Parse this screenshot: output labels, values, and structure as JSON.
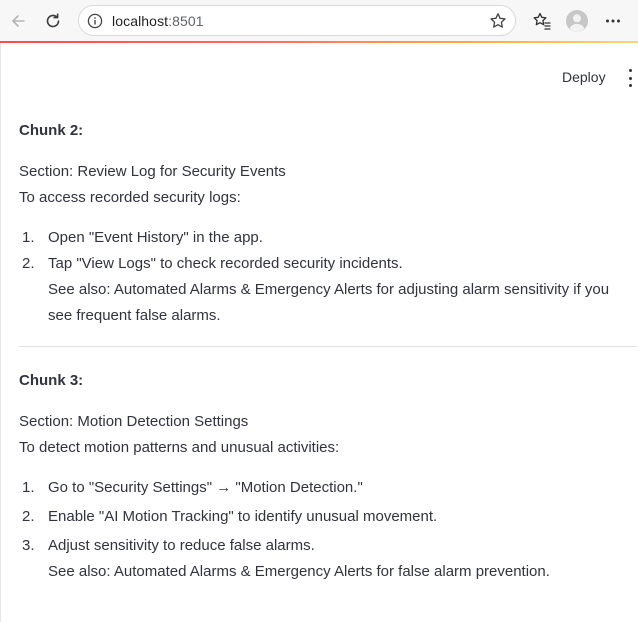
{
  "browser": {
    "url_host": "localhost",
    "url_port": ":8501"
  },
  "header": {
    "deploy_label": "Deploy"
  },
  "chunks": [
    {
      "title": "Chunk 2:",
      "section": "Section: Review Log for Security Events",
      "intro": "To access recorded security logs:",
      "steps": [
        {
          "num": "1.",
          "text": "Open \"Event History\" in the app."
        },
        {
          "num": "2.",
          "text": "Tap \"View Logs\" to check recorded security incidents.",
          "see_also": "See also: Automated Alarms & Emergency Alerts for adjusting alarm sensitivity if you see frequent false alarms."
        }
      ]
    },
    {
      "title": "Chunk 3:",
      "section": "Section: Motion Detection Settings",
      "intro": "To detect motion patterns and unusual activities:",
      "steps": [
        {
          "num": "1.",
          "text": "Go to \"Security Settings\" → \"Motion Detection.\""
        },
        {
          "num": "2.",
          "text": "Enable \"AI Motion Tracking\" to identify unusual movement."
        },
        {
          "num": "3.",
          "text": "Adjust sensitivity to reduce false alarms.",
          "see_also": "See also: Automated Alarms & Emergency Alerts for false alarm prevention."
        }
      ]
    }
  ]
}
